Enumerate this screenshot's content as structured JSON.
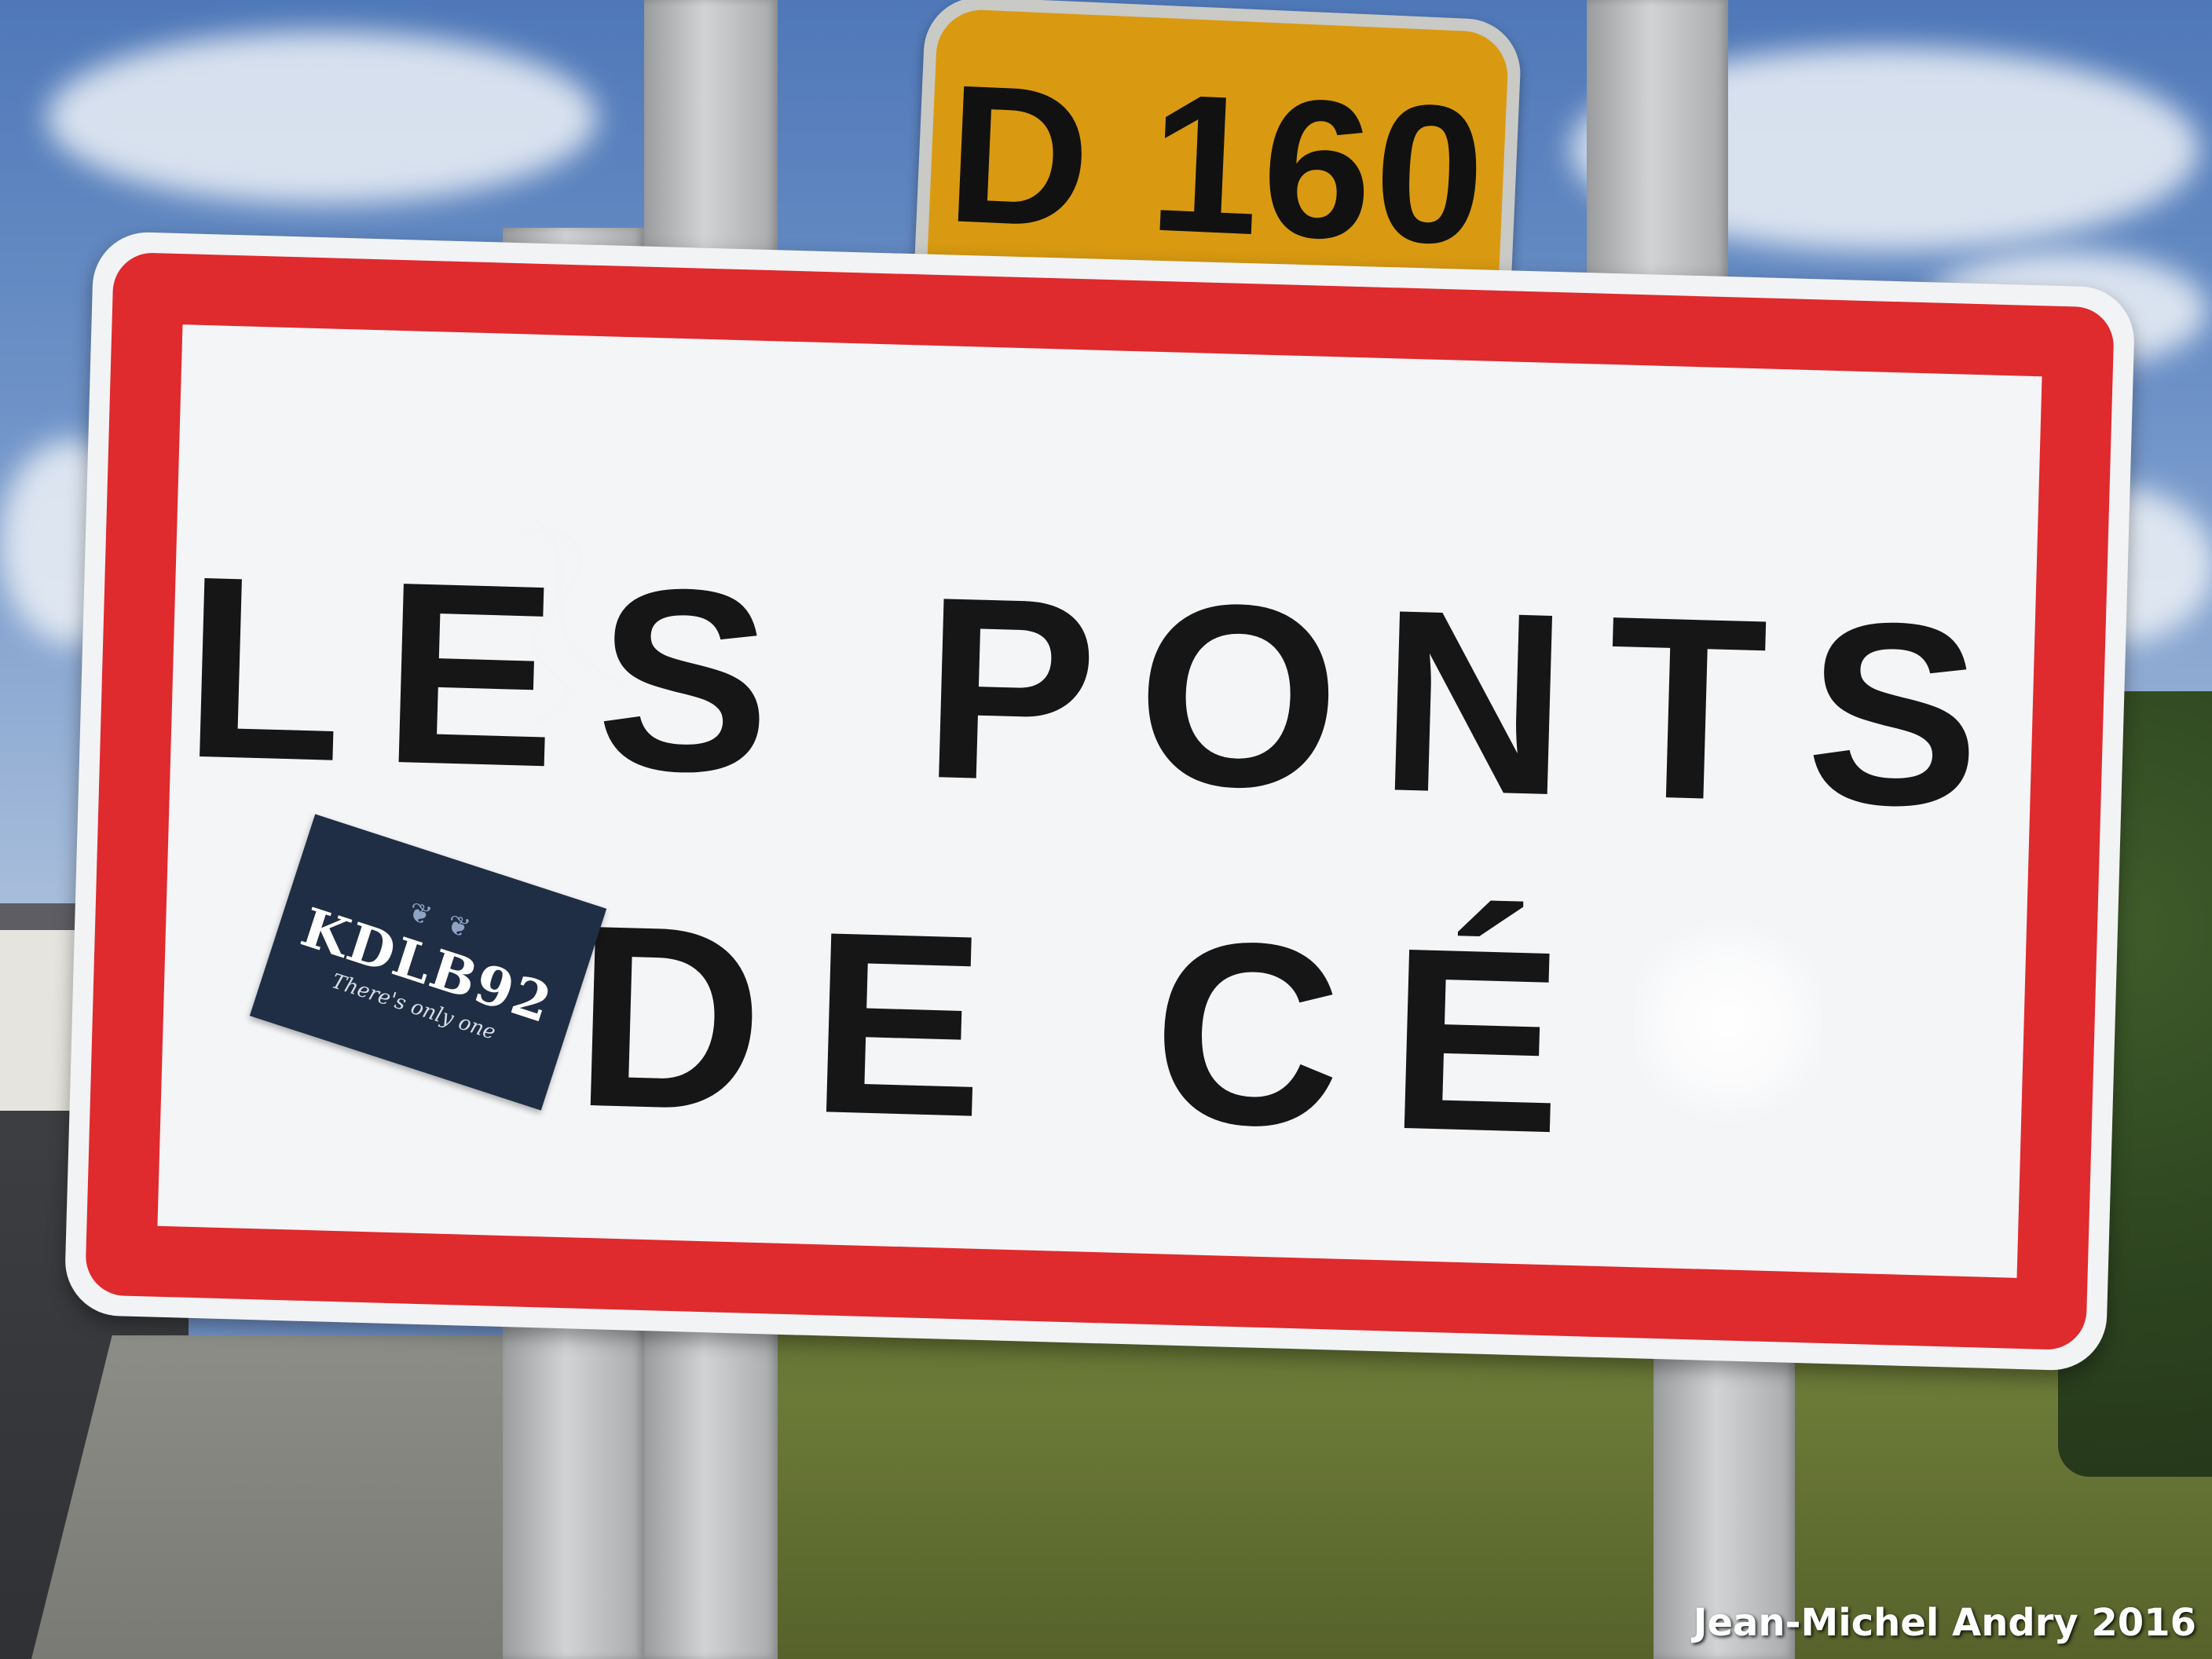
{
  "route_sign": {
    "text": "D 160",
    "color": "#d99a12"
  },
  "town_sign": {
    "line1": "LES PONTS",
    "line2": "DE CÉ",
    "border_color": "#df2a2e"
  },
  "sticker": {
    "main": "KDLB92",
    "sub": "There's only one"
  },
  "credit": "Jean-Michel Andry 2016"
}
